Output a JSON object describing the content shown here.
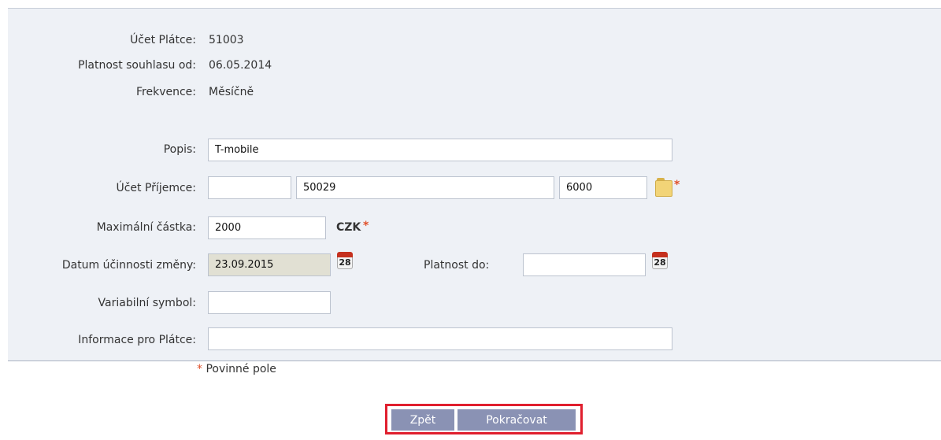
{
  "info": {
    "ucet_platce_label": "Účet Plátce:",
    "ucet_platce_value": "51003",
    "platnost_label": "Platnost souhlasu od:",
    "platnost_value": "06.05.2014",
    "frekvence_label": "Frekvence:",
    "frekvence_value": "Měsíčně"
  },
  "form": {
    "popis_label": "Popis:",
    "popis_value": "T-mobile",
    "ucet_prijemce_label": "Účet Příjemce:",
    "ucet_prefix_value": "",
    "ucet_number_value": "50029",
    "ucet_bank_value": "6000",
    "max_castka_label": "Maximální částka:",
    "max_castka_value": "2000",
    "currency": "CZK",
    "datum_label": "Datum účinnosti změny:",
    "datum_value": "23.09.2015",
    "platnost_do_label": "Platnost do:",
    "platnost_do_value": "",
    "vs_label": "Variabilní symbol:",
    "vs_value": "",
    "info_platce_label": "Informace pro Plátce:",
    "info_platce_value": "",
    "required_mark": "*",
    "required_note": "Povinné pole",
    "calendar_day": "28"
  },
  "buttons": {
    "back": "Zpět",
    "continue": "Pokračovat"
  },
  "icons": {
    "calendar": "calendar-icon",
    "address_book": "folder-icon"
  },
  "colors": {
    "required": "#e0502a",
    "button": "#8a92b4",
    "highlight_border": "#e01f2e",
    "panel": "#eef1f6"
  }
}
